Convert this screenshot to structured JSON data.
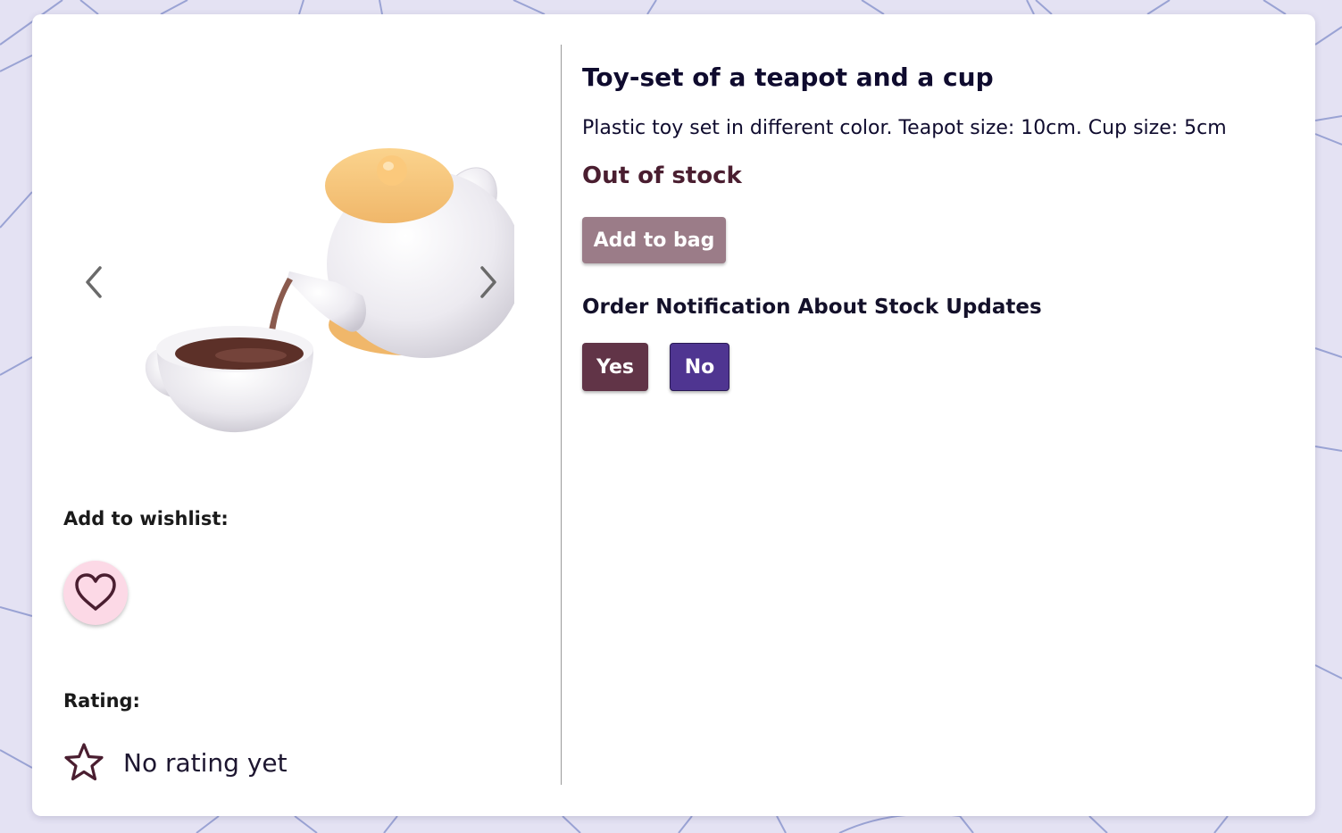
{
  "product": {
    "title": "Toy-set of a teapot and a cup",
    "description": "Plastic toy set in different color. Teapot size: 10cm. Cup size: 5cm",
    "stock_status": "Out of stock",
    "add_to_bag_label": "Add to bag",
    "image_alt": "teapot-pouring-into-cup"
  },
  "notification": {
    "heading": "Order Notification About Stock Updates",
    "yes_label": "Yes",
    "no_label": "No"
  },
  "wishlist": {
    "label": "Add to wishlist:",
    "icon": "heart-outline-icon"
  },
  "rating": {
    "label": "Rating:",
    "text": "No rating yet",
    "icon": "star-outline-icon"
  },
  "carousel": {
    "prev_icon": "chevron-left-icon",
    "next_icon": "chevron-right-icon"
  },
  "colors": {
    "background": "#e4e2f3",
    "card": "#ffffff",
    "add_to_bag_disabled": "#9b7c88",
    "yes_button": "#613447",
    "no_button": "#4f3591",
    "wishlist_circle": "#fcd9e6",
    "stock_status": "#4a1e30"
  }
}
